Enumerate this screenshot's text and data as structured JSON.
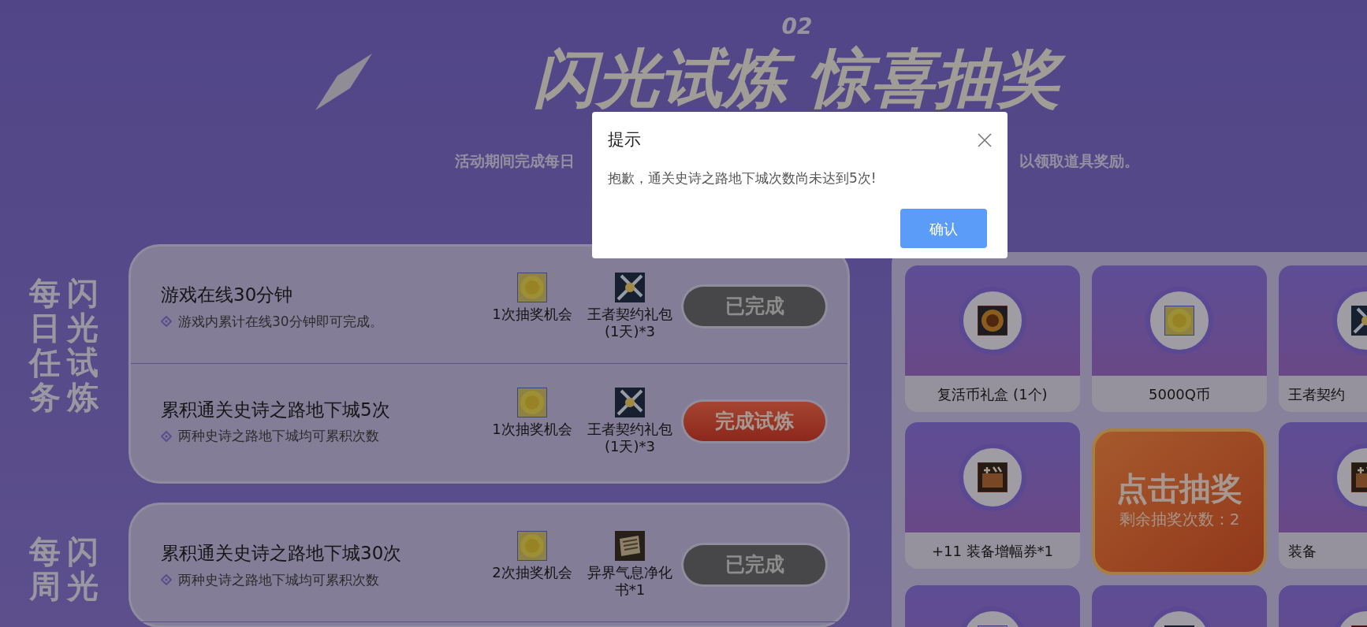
{
  "header": {
    "number": "02",
    "title": "闪光试炼 惊喜抽奖",
    "subtitle_parts": [
      "活动期间完成每日",
      "以领取道具奖励。"
    ]
  },
  "sections": [
    {
      "label": [
        "每日任务",
        "闪光试炼"
      ],
      "tasks": [
        {
          "title": "游戏在线30分钟",
          "desc": "游戏内累计在线30分钟即可完成。",
          "rewards": [
            {
              "kind": "coin",
              "label": "1次抽奖机会"
            },
            {
              "kind": "pack",
              "label": "王者契约礼包(1天)*3"
            }
          ],
          "button": {
            "label": "已完成",
            "done": true
          }
        },
        {
          "title": "累积通关史诗之路地下城5次",
          "desc": "两种史诗之路地下城均可累积次数",
          "rewards": [
            {
              "kind": "coin",
              "label": "1次抽奖机会"
            },
            {
              "kind": "pack",
              "label": "王者契约礼包(1天)*3"
            }
          ],
          "button": {
            "label": "完成试炼",
            "done": false
          }
        }
      ]
    },
    {
      "label": [
        "每周",
        "闪光"
      ],
      "tasks": [
        {
          "title": "累积通关史诗之路地下城30次",
          "desc": "两种史诗之路地下城均可累积次数",
          "rewards": [
            {
              "kind": "coin",
              "label": "2次抽奖机会"
            },
            {
              "kind": "book",
              "label": "异界气息净化书*1"
            }
          ],
          "button": {
            "label": "已完成",
            "done": true
          }
        }
      ]
    }
  ],
  "prize_grid": [
    {
      "kind": "prize",
      "label": "复活币礼盒 (1个)"
    },
    {
      "kind": "prize",
      "label": "5000Q币"
    },
    {
      "kind": "prize",
      "label": "王者契约"
    },
    {
      "kind": "prize",
      "label": "+11 装备增幅券*1"
    },
    {
      "kind": "draw",
      "title": "点击抽奖",
      "remaining": "剩余抽奖次数：2"
    },
    {
      "kind": "prize",
      "label": "装备"
    },
    {
      "kind": "prize"
    },
    {
      "kind": "prize"
    },
    {
      "kind": "prize"
    }
  ],
  "dialog": {
    "title": "提示",
    "message": "抱歉，通关史诗之路地下城次数尚未达到5次!",
    "confirm": "确认"
  }
}
